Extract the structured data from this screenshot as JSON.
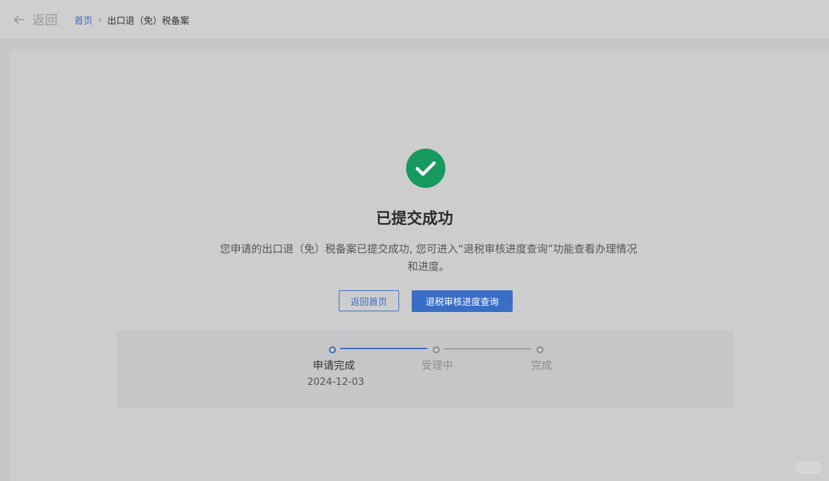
{
  "header": {
    "back_label": "返回",
    "breadcrumb": {
      "home": "首页",
      "separator": "›",
      "current": "出口退（免）税备案"
    }
  },
  "result": {
    "title": "已提交成功",
    "description_line1": "您申请的出口退（免）税备案已提交成功, 您可进入“退税审核进度查询”功能查看办理情况",
    "description_line2": "和进度。"
  },
  "actions": {
    "home_button": "返回首页",
    "query_button": "退税审核进度查询"
  },
  "steps": [
    {
      "label": "申请完成",
      "date": "2024-12-03",
      "status": "done"
    },
    {
      "label": "受理中",
      "date": "",
      "status": "pending"
    },
    {
      "label": "完成",
      "date": "",
      "status": "pending"
    }
  ],
  "colors": {
    "accent": "#3d6cbf",
    "success": "#179a5f"
  }
}
